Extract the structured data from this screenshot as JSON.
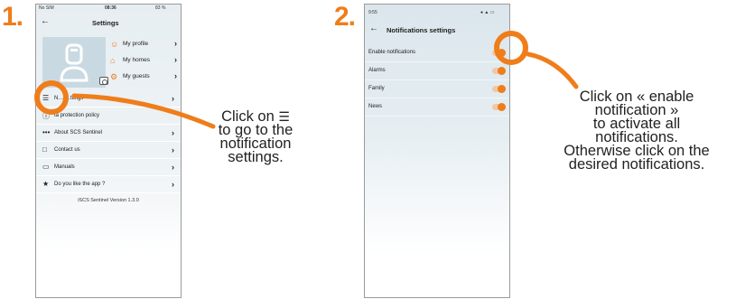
{
  "steps": [
    "1.",
    "2."
  ],
  "phone1": {
    "status_left": "No SIM",
    "status_time": "08:36",
    "status_right": "83 %",
    "title": "Settings",
    "profile_items": [
      {
        "label": "My profile",
        "icon": "person-icon"
      },
      {
        "label": "My homes",
        "icon": "home-icon"
      },
      {
        "label": "My guests",
        "icon": "guests-icon"
      }
    ],
    "menu_items": [
      {
        "label": "Notification settings",
        "icon": "sliders-icon",
        "visible_label": "N…              …ttings"
      },
      {
        "label": "Data protection policy",
        "icon": "info-icon",
        "visible_label": "ta protection policy"
      },
      {
        "label": "About SCS Sentinel",
        "icon": "dots-icon"
      },
      {
        "label": "Contact us",
        "icon": "chat-icon"
      },
      {
        "label": "Manuals",
        "icon": "document-icon"
      },
      {
        "label": "Do you like the app ?",
        "icon": "star-icon"
      }
    ],
    "version": "iSCS Sentinel Version 1.3.0"
  },
  "phone2": {
    "status_time": "9:55",
    "title": "Notifications settings",
    "rows": [
      {
        "label": "Enable notifications",
        "on": true
      },
      {
        "label": "Alarms",
        "on": true
      },
      {
        "label": "Family",
        "on": true
      },
      {
        "label": "News",
        "on": true
      }
    ]
  },
  "caption1": [
    "Click on",
    "to go to the",
    "notification",
    "settings."
  ],
  "caption2": [
    "Click on « enable",
    "notification »",
    "to activate all",
    "notifications.",
    "Otherwise click on the",
    "desired notifications."
  ],
  "colors": {
    "accent": "#ef7d1a",
    "text": "#222222"
  }
}
